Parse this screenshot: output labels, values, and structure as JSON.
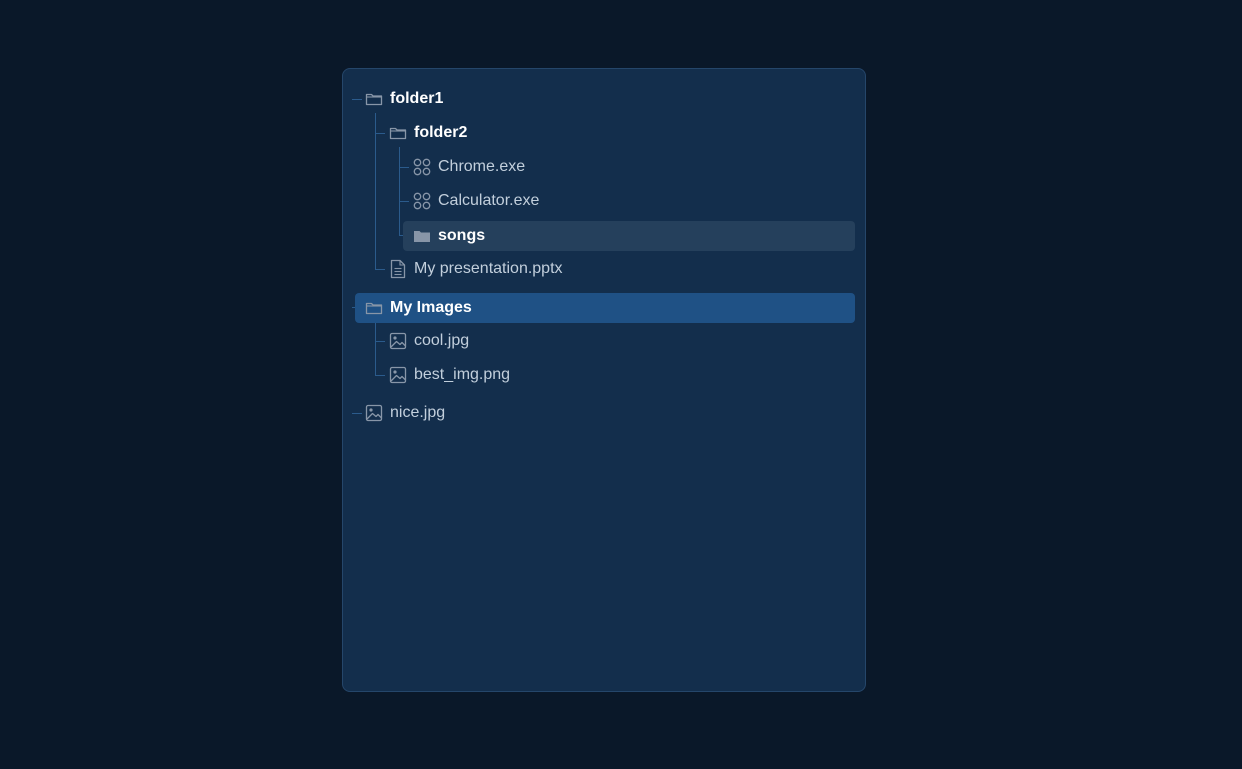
{
  "colors": {
    "page_background": "#0a1829",
    "panel_background": "#132e4c",
    "panel_border": "#25466a",
    "tree_line": "#2b5b8c",
    "hover_background": "#25405c",
    "selected_background": "#1f5185",
    "folder_label": "#ffffff",
    "file_label": "#c2cfdc",
    "icon": "#8896a8"
  },
  "tree": {
    "folder1": {
      "label": "folder1",
      "icon": "folder-outline-icon"
    },
    "folder2": {
      "label": "folder2",
      "icon": "folder-outline-icon"
    },
    "chrome": {
      "label": "Chrome.exe",
      "icon": "app-grid-icon"
    },
    "calculator": {
      "label": "Calculator.exe",
      "icon": "app-grid-icon"
    },
    "songs": {
      "label": "songs",
      "icon": "folder-filled-icon",
      "state": "hover"
    },
    "presentation": {
      "label": "My presentation.pptx",
      "icon": "document-icon"
    },
    "my_images": {
      "label": "My Images",
      "icon": "folder-outline-icon",
      "state": "selected"
    },
    "cool": {
      "label": "cool.jpg",
      "icon": "image-icon"
    },
    "best_img": {
      "label": "best_img.png",
      "icon": "image-icon"
    },
    "nice": {
      "label": "nice.jpg",
      "icon": "image-icon"
    }
  }
}
